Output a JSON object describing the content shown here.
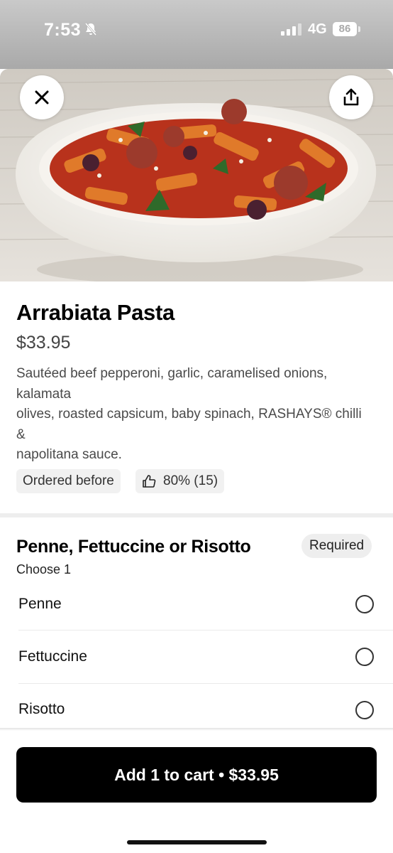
{
  "status_bar": {
    "time": "7:53",
    "network": "4G",
    "battery": "86"
  },
  "header": {
    "close_icon": "close-icon",
    "share_icon": "share-icon"
  },
  "item": {
    "name": "Arrabiata Pasta",
    "price": "$33.95",
    "description_lines": [
      "Sautéed beef pepperoni, garlic, caramelised onions,",
      "kalamata",
      "olives, roasted capsicum, baby spinach, RASHAYS® chilli",
      "&",
      "napolitana sauce."
    ],
    "badges": {
      "ordered_before": "Ordered before",
      "rating": "80% (15)"
    }
  },
  "options_group": {
    "title": "Penne, Fettuccine or Risotto",
    "required_label": "Required",
    "subtitle": "Choose 1",
    "options": [
      {
        "label": "Penne",
        "selected": false
      },
      {
        "label": "Fettuccine",
        "selected": false
      },
      {
        "label": "Risotto",
        "selected": false
      }
    ]
  },
  "cart_button": {
    "label": "Add 1 to cart • $33.95"
  }
}
